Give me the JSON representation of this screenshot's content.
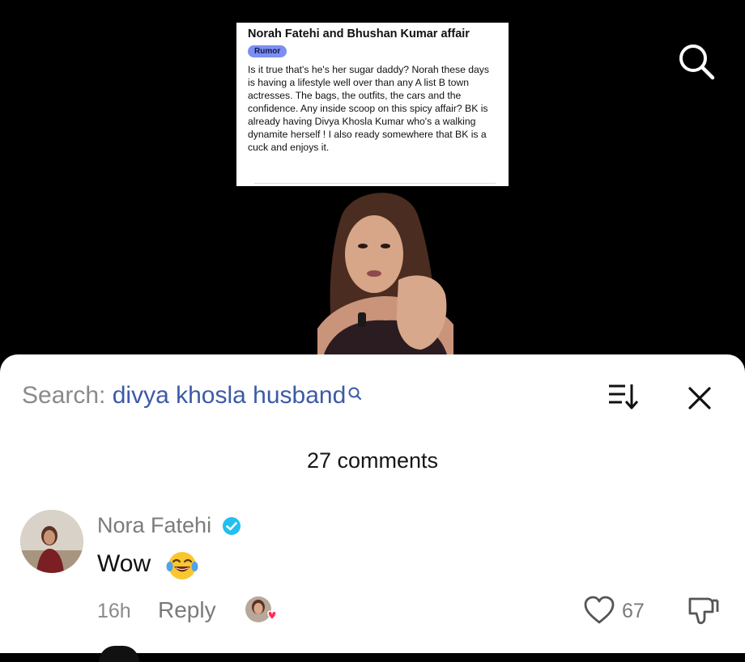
{
  "video": {
    "post_card": {
      "title": "Norah Fatehi and Bhushan Kumar affair",
      "tag": "Rumor",
      "body": "Is it true that's he's her sugar daddy? Norah these days is having a lifestyle well over than any A list B town actresses. The bags, the outfits, the cars and the confidence. Any inside scoop on this spicy affair? BK is already having Divya Khosla Kumar who's a walking dynamite herself ! I also ready somewhere that BK is a cuck and enjoys it."
    },
    "search_icon": "search-icon"
  },
  "sheet": {
    "search_prefix": "Search: ",
    "search_query": "divya khosla husband",
    "sort_icon": "sort-icon",
    "close_icon": "close-icon",
    "comment_count": "27 comments"
  },
  "comments": [
    {
      "author": "Nora Fatehi",
      "verified": true,
      "text": "Wow",
      "emoji": "face-with-tears-of-joy",
      "time": "16h",
      "reply_label": "Reply",
      "likes": "67",
      "liked_by_creator": true
    }
  ],
  "colors": {
    "tag_bg": "#7c8ff1",
    "query_blue": "#3c5aa6",
    "verified_blue": "#20c0f0",
    "heart_red": "#fe2c55"
  }
}
